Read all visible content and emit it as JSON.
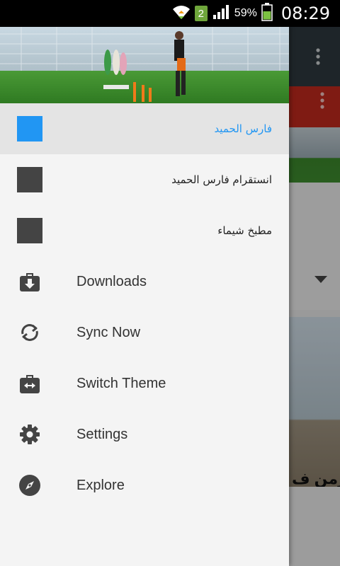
{
  "status_bar": {
    "sim_label": "2",
    "battery_text": "59%",
    "time": "08:29"
  },
  "background": {
    "photo_caption_fragment": "رمن ف"
  },
  "drawer": {
    "accounts": [
      {
        "label": "فارس الحميد",
        "active": true
      },
      {
        "label": "انستقرام فارس الحميد",
        "active": false
      },
      {
        "label": "مطبخ شيماء",
        "active": false
      }
    ],
    "menu": [
      {
        "label": "Downloads",
        "icon": "downloads-icon"
      },
      {
        "label": "Sync Now",
        "icon": "sync-icon"
      },
      {
        "label": "Switch Theme",
        "icon": "switch-theme-icon"
      },
      {
        "label": "Settings",
        "icon": "gear-icon"
      },
      {
        "label": "Explore",
        "icon": "compass-icon"
      }
    ]
  },
  "colors": {
    "accent": "#2196f3",
    "drawer_bg": "#f4f4f4",
    "active_row_bg": "#e4e4e4",
    "icon": "#444444",
    "toolbar": "#2f3a3f",
    "red_bar": "#c42a1e"
  }
}
